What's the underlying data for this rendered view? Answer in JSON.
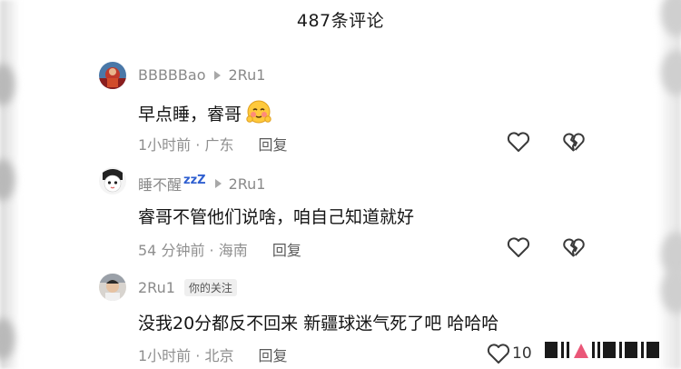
{
  "header": {
    "title": "487条评论"
  },
  "comments": [
    {
      "username": "BBBBBao",
      "reply_to": "2Ru1",
      "text": "早点睡，睿哥",
      "time": "1小时前 · 广东",
      "reply_label": "回复"
    },
    {
      "username": "睡不醒",
      "username_suffix": "zzZ",
      "reply_to": "2Ru1",
      "text": "睿哥不管他们说啥，咱自己知道就好",
      "time": "54 分钟前 · 海南",
      "reply_label": "回复"
    },
    {
      "username": "2Ru1",
      "tag": "你的关注",
      "text": "没我20分都反不回来 新疆球迷气死了吧 哈哈哈",
      "time": "1小时前 · 北京",
      "reply_label": "回复",
      "like_count": "10"
    }
  ],
  "icons": {
    "like": "heart-outline-icon",
    "dislike": "broken-heart-icon",
    "reply_indicator": "triangle-arrow-icon",
    "emoji": "blushing-face-emoji"
  },
  "colors": {
    "text_primary": "#141414",
    "text_secondary": "#8f8f8f",
    "username": "#8a8a8a",
    "icon_stroke": "#3a3a3a"
  }
}
